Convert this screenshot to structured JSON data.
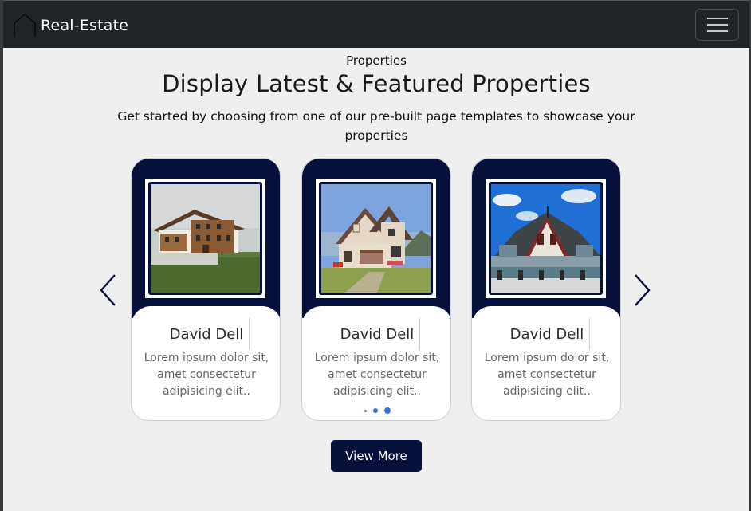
{
  "navbar": {
    "brand": "Real-Estate",
    "brand_icon": "house-outline-icon",
    "menu_icon": "hamburger-menu-icon"
  },
  "section": {
    "eyebrow": "Properties",
    "title": "Display Latest & Featured Properties",
    "subtitle": "Get started by choosing from one of our pre-built page templates to showcase your properties"
  },
  "carousel": {
    "prev_icon": "chevron-left-icon",
    "next_icon": "chevron-right-icon",
    "cards": [
      {
        "name": "David Dell",
        "description": "Lorem ipsum dolor sit, amet consectetur adipisicing elit..",
        "image": "farmhouse-photo"
      },
      {
        "name": "David Dell",
        "description": "Lorem ipsum dolor sit, amet consectetur adipisicing elit..",
        "image": "cottage-photo"
      },
      {
        "name": "David Dell",
        "description": "Lorem ipsum dolor sit, amet consectetur adipisicing elit..",
        "image": "victorian-house-photo"
      }
    ],
    "dots": 3,
    "active_dot": 3
  },
  "cta": {
    "label": "View More"
  },
  "colors": {
    "navy": "#06103a",
    "navbar": "#212529",
    "page_bg": "#efefef",
    "dot": "#3a6fd8"
  }
}
